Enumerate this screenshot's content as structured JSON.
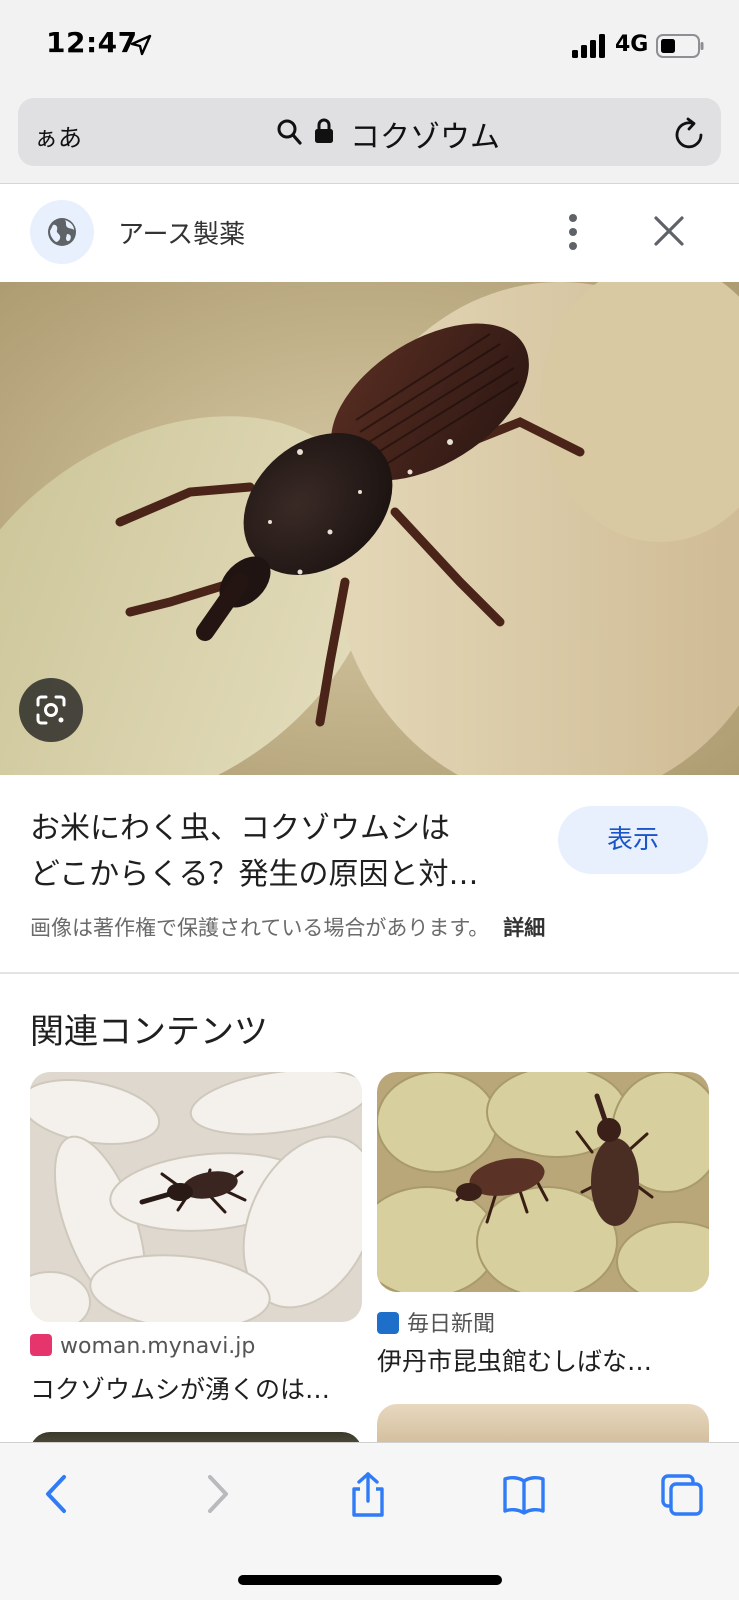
{
  "status_bar": {
    "time": "12:47",
    "network": "4G",
    "location_icon": "location-arrow-icon",
    "signal_icon": "cell-signal-icon",
    "battery_icon": "battery-icon"
  },
  "address_bar": {
    "text_size_label": "ぁあ",
    "url_text": "コクゾウム",
    "search_icon": "search-icon",
    "lock_icon": "lock-icon",
    "reload_icon": "reload-icon"
  },
  "source": {
    "name": "アース製薬",
    "globe_icon": "globe-icon",
    "more_icon": "more-vertical-icon",
    "close_icon": "close-icon"
  },
  "image_result": {
    "lens_icon": "lens-search-icon",
    "title_lines": [
      "お米にわく虫、コクゾウムシは",
      "どこからくる？発生の原因と対…"
    ],
    "visit_label": "表示",
    "copyright_text": "画像は著作権で保護されている場合があります。",
    "details_label": "詳細"
  },
  "related": {
    "heading": "関連コンテンツ",
    "cards": [
      {
        "source": "woman.mynavi.jp",
        "title": "コクゾウムシが湧くのは…"
      },
      {
        "source": "毎日新聞",
        "title": "伊丹市昆虫館むしばな…"
      }
    ]
  },
  "toolbar": {
    "back_icon": "back-icon",
    "forward_icon": "forward-icon",
    "share_icon": "share-icon",
    "bookmarks_icon": "bookmarks-icon",
    "tabs_icon": "tabs-icon"
  },
  "colors": {
    "accent_blue": "#1a56c9",
    "visit_button_bg": "#e8f0fe",
    "toolbar_icon_blue": "#2f7cf6",
    "toolbar_icon_disabled": "#b9b9be"
  }
}
